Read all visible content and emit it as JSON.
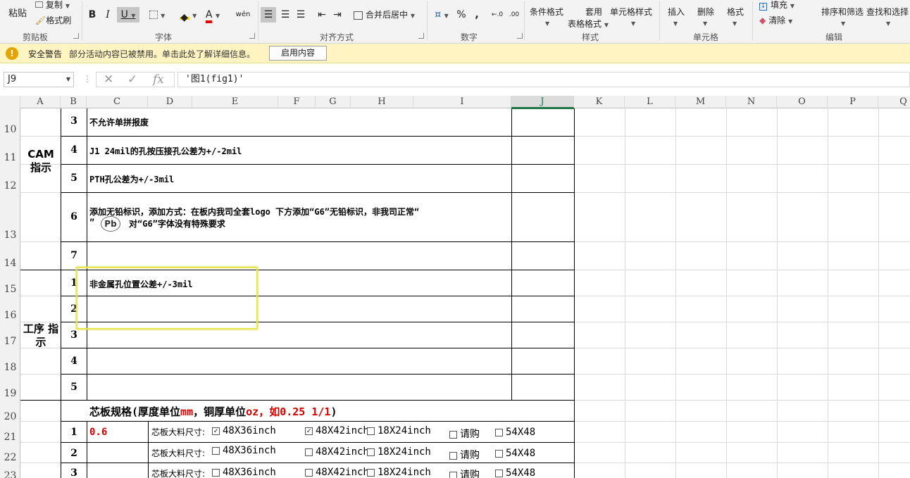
{
  "ribbon": {
    "clipboard": {
      "paste": "粘贴",
      "copy": "复制",
      "format_painter": "格式刷",
      "group": "剪贴板"
    },
    "font": {
      "bold": "B",
      "italic": "I",
      "underline": "U",
      "wen": "wén",
      "color_a": "A",
      "group": "字体"
    },
    "align": {
      "merge": "合并后居中",
      "group": "对齐方式"
    },
    "number": {
      "percent": "%",
      "comma": ",",
      "group": "数字"
    },
    "styles": {
      "conditional": "条件格式",
      "table_format_1": "套用",
      "table_format_2": "表格格式",
      "cell_styles": "单元格样式",
      "group": "样式"
    },
    "cells": {
      "insert": "插入",
      "delete": "删除",
      "format": "格式",
      "group": "单元格"
    },
    "editing": {
      "fill": "填充",
      "clear": "清除",
      "sort": "排序和筛选",
      "find": "查找和选择",
      "group": "编辑"
    }
  },
  "security": {
    "title": "安全警告",
    "message": "部分活动内容已被禁用。单击此处了解详细信息。",
    "button": "启用内容"
  },
  "formula_bar": {
    "name_box": "J9",
    "fx": "fx",
    "content": "'图1(fig1)'"
  },
  "columns": [
    "A",
    "B",
    "C",
    "D",
    "E",
    "F",
    "G",
    "H",
    "I",
    "J",
    "K",
    "L",
    "M",
    "N",
    "O",
    "P",
    "Q"
  ],
  "rows": [
    "10",
    "11",
    "12",
    "13",
    "14",
    "15",
    "16",
    "17",
    "18",
    "19",
    "20",
    "21",
    "22",
    "23"
  ],
  "sections": {
    "cam": "CAM 指示",
    "process": "工序 指示"
  },
  "cam_items": [
    {
      "num": "3",
      "text": "不允许单拼报废"
    },
    {
      "num": "4",
      "text": "J1 24mil的孔按压接孔公差为+/-2mil"
    },
    {
      "num": "5",
      "text": "PTH孔公差为+/-3mil"
    },
    {
      "num": "6",
      "text_line1": "添加无铅标识，添加方式：在板内我司全套logo 下方添加“G6”无铅标识，非我司正常“",
      "text_line2": "”",
      "text_line2b": "对“G6”字体没有特殊要求",
      "pb": "Pb"
    },
    {
      "num": "7",
      "text": ""
    }
  ],
  "process_items": [
    {
      "num": "1",
      "text": "非金属孔位置公差+/-3mil"
    },
    {
      "num": "2",
      "text": ""
    },
    {
      "num": "3",
      "text": ""
    },
    {
      "num": "4",
      "text": ""
    },
    {
      "num": "5",
      "text": ""
    }
  ],
  "core": {
    "title_a": "芯板规格(厚度单位",
    "title_mm": "mm",
    "title_b": "，铜厚单位",
    "title_oz": "oz",
    "title_c": "，如",
    "title_example": "0.25 1/1",
    "title_d": ")",
    "rows": [
      {
        "num": "1",
        "thickness": "0.6",
        "label": "芯板大料尺寸:",
        "s1": "48X36inch",
        "s2": "48X42inch",
        "s3": "18X24inch",
        "s4": "请购",
        "s5": "54X48",
        "c1": "✓",
        "c2": "✓"
      },
      {
        "num": "2",
        "thickness": "",
        "label": "芯板大料尺寸:",
        "s1": "48X36inch",
        "s2": "48X42inch",
        "s3": "18X24inch",
        "s4": "请购",
        "s5": "54X48",
        "c1": "",
        "c2": ""
      },
      {
        "num": "3",
        "thickness": "",
        "label": "芯板大料尺寸:",
        "s1": "48X36inch",
        "s2": "48X42inch",
        "s3": "18X24inch",
        "s4": "请购",
        "s5": "54X48",
        "c1": "",
        "c2": ""
      }
    ]
  }
}
